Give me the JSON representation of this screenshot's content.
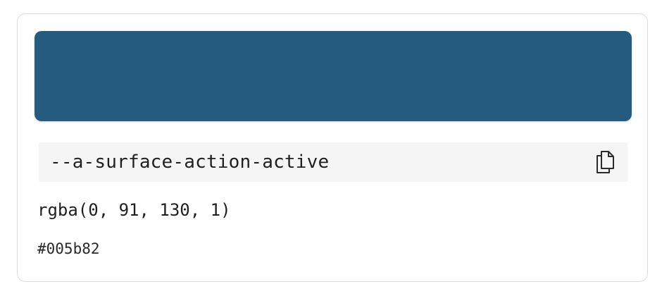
{
  "swatch": {
    "color": "#245b7e"
  },
  "token": {
    "name": "--a-surface-action-active",
    "copy_icon": "copy-icon"
  },
  "values": {
    "rgba": "rgba(0, 91, 130, 1)",
    "hex": "#005b82"
  }
}
